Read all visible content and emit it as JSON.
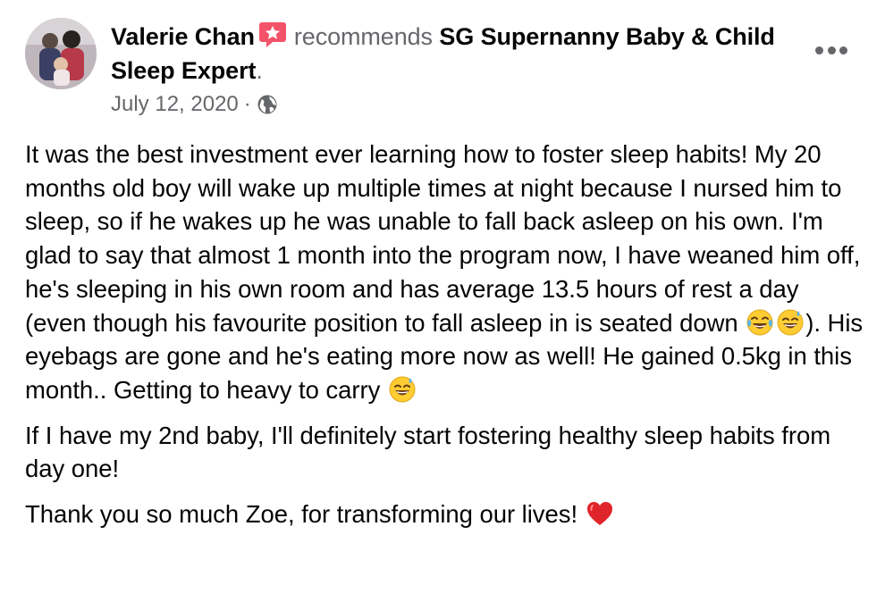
{
  "post": {
    "author_name": "Valerie Chan",
    "verb": "recommends",
    "page_name": "SG Supernanny Baby & Child Sleep Expert",
    "period": ".",
    "date": "July 12, 2020",
    "separator": "·",
    "privacy_icon": "globe-icon",
    "badge_icon": "recommend-star-icon",
    "more_icon": "more-options-icon"
  },
  "body": {
    "paragraph_1_a": "It was the best investment ever learning how to foster sleep habits! My 20 months old boy will wake up multiple times at night because I nursed him to sleep, so if he wakes up he was unable to fall back asleep on his own. I'm glad to say that almost 1 month into the program now, I have weaned him off, he's sleeping in his own room and has average 13.5 hours of rest a day (even though his favourite position to fall asleep in is seated down ",
    "paragraph_1_b": "). His eyebags are gone and he's eating more now as well! He gained 0.5kg in this month.. Getting to heavy to carry ",
    "paragraph_2": "If I have my 2nd baby, I'll definitely start fostering healthy sleep habits from day one!",
    "paragraph_3": "Thank you so much Zoe, for transforming our lives! ",
    "emojis": [
      "tears-of-joy-emoji",
      "grinning-sweat-emoji",
      "grinning-sweat-emoji",
      "red-heart-emoji"
    ]
  },
  "colors": {
    "text_primary": "#050505",
    "text_secondary": "#65676b",
    "badge": "#f35369",
    "heart": "#e0242b",
    "emoji_yellow": "#ffcc33"
  }
}
